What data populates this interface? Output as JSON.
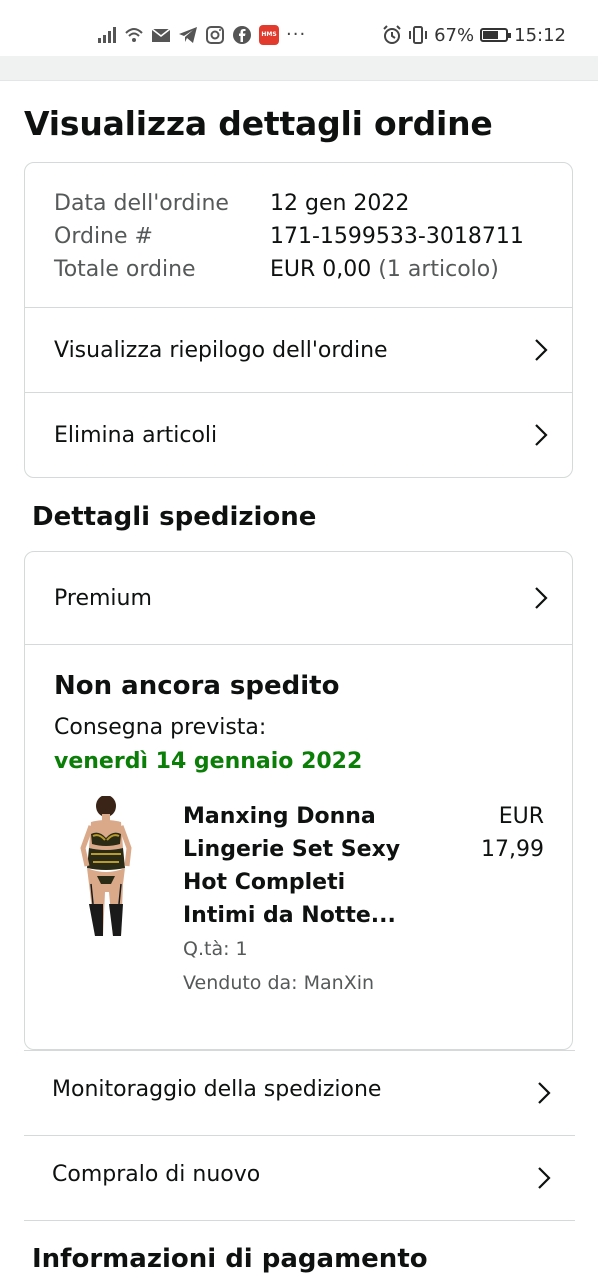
{
  "status_bar": {
    "battery": "67%",
    "time": "15:12",
    "battery_level": 0.67,
    "more": "···",
    "hms_badge": "HMS"
  },
  "page": {
    "title": "Visualizza dettagli ordine"
  },
  "order_summary": {
    "rows": [
      {
        "label": "Data dell'ordine",
        "value": "12 gen 2022"
      },
      {
        "label": "Ordine #",
        "value": "171-1599533-3018711"
      },
      {
        "label": "Totale ordine",
        "value": "EUR 0,00",
        "extra": "(1 articolo)"
      }
    ],
    "links": [
      {
        "label": "Visualizza riepilogo dell'ordine"
      },
      {
        "label": "Elimina articoli"
      }
    ]
  },
  "shipping": {
    "title": "Dettagli spedizione",
    "method": "Premium",
    "status": "Non ancora spedito",
    "delivery_label": "Consegna prevista:",
    "delivery_date": "venerdì 14 gennaio 2022",
    "item": {
      "title_lines": [
        "Manxing Donna",
        "Lingerie Set Sexy",
        "Hot Completi",
        "Intimi da Notte..."
      ],
      "price_lines": [
        "EUR",
        "17,99"
      ],
      "qty": "Q.tà: 1",
      "seller": "Venduto da: ManXin"
    },
    "actions": [
      {
        "label": "Monitoraggio della spedizione"
      },
      {
        "label": "Compralo di nuovo"
      }
    ]
  },
  "payment": {
    "title": "Informazioni di pagamento"
  },
  "colors": {
    "delivery_green": "#0a7e07",
    "border": "#d5d9d9",
    "muted_text": "#565959"
  }
}
